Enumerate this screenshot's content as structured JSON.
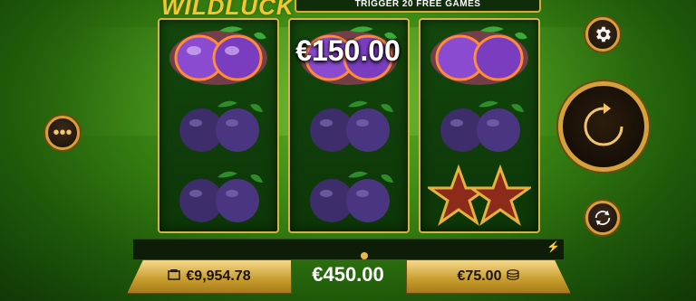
{
  "header": {
    "logo_text": "WILDLUCK",
    "banner_text": "TRIGGER 20 FREE GAMES"
  },
  "reels": [
    {
      "symbols": [
        "plum-fire",
        "plum",
        "plum"
      ]
    },
    {
      "symbols": [
        "plum-fire",
        "plum",
        "plum"
      ]
    },
    {
      "symbols": [
        "plum-fire",
        "plum",
        "star"
      ]
    }
  ],
  "win_display": "€150.00",
  "balance": {
    "icon": "wallet-icon",
    "value": "€9,954.78"
  },
  "total_win": "€450.00",
  "bet": {
    "icon": "coins-icon",
    "value": "€75.00"
  },
  "buttons": {
    "menu_icon": "more-icon",
    "settings_icon": "gear-icon",
    "spin_icon": "spin-icon",
    "autoplay_icon": "autoplay-icon"
  },
  "colors": {
    "gold": "#d9b14a",
    "green_bg": "#3d8a14",
    "plum": "#4a2f7a"
  }
}
